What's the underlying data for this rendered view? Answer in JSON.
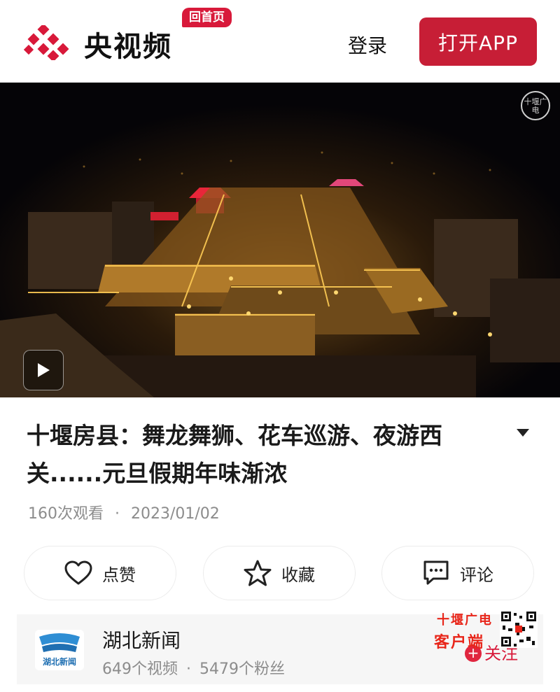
{
  "header": {
    "brand": "央视频",
    "home_badge": "回首页",
    "login": "登录",
    "open_app": "打开APP",
    "logo_icon": "cctv-video-logo-icon",
    "accent_color": "#c71e36"
  },
  "video": {
    "play_icon": "play-icon",
    "seal_text": "十堰广电"
  },
  "article": {
    "title": "十堰房县：舞龙舞狮、花车巡游、夜游西关......元旦假期年味渐浓",
    "views": "160次观看",
    "separator": "·",
    "date": "2023/01/02"
  },
  "actions": [
    {
      "label": "点赞",
      "icon": "heart-icon"
    },
    {
      "label": "收藏",
      "icon": "star-icon"
    },
    {
      "label": "评论",
      "icon": "comment-icon"
    }
  ],
  "channel": {
    "name": "湖北新闻",
    "videos": "649个视频",
    "separator": "·",
    "fans": "5479个粉丝",
    "follow": "关注",
    "follow_plus": "+",
    "logo_text": "湖北新闻"
  },
  "watermark": {
    "line1": "十堰广电",
    "line2": "客户端"
  }
}
